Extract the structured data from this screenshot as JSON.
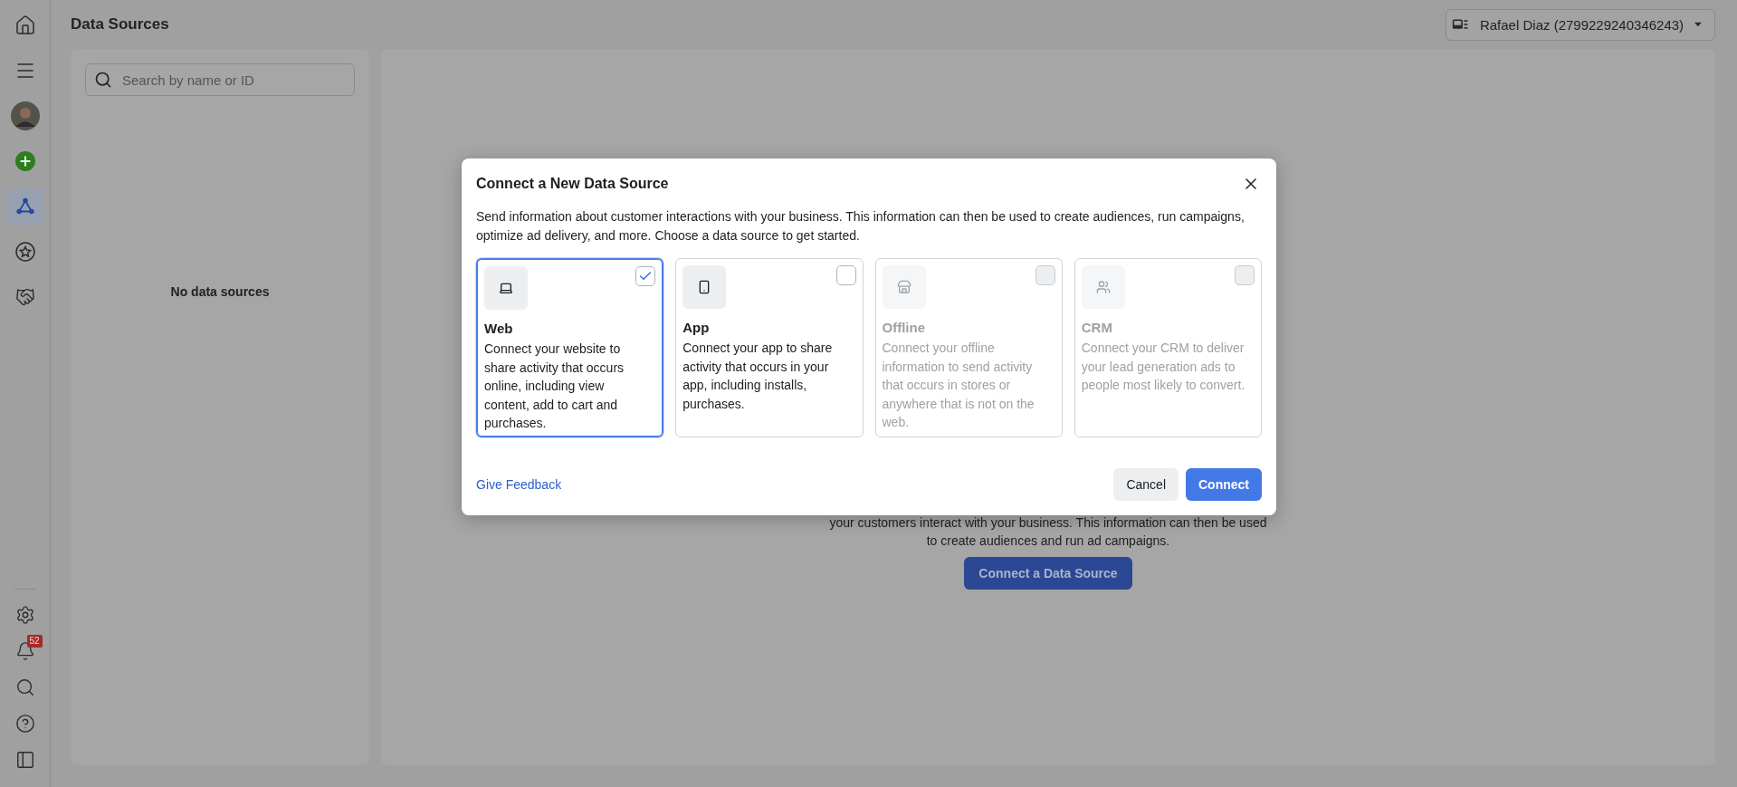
{
  "sidebar": {
    "top_items": [
      {
        "selected": false
      },
      {
        "selected": false
      },
      {
        "selected": false
      },
      {
        "selected": false
      },
      {
        "selected": true
      },
      {
        "selected": false
      },
      {
        "selected": false
      }
    ],
    "bottom_items": [
      {
        "selected": false
      },
      {
        "selected": false,
        "badge": "52"
      },
      {
        "selected": false
      },
      {
        "selected": false
      },
      {
        "selected": false
      }
    ]
  },
  "header": {
    "title": "Data Sources",
    "account": "Rafael Diaz (2799229240346243)"
  },
  "list_panel": {
    "search": {
      "placeholder": "Search by name or ID"
    },
    "empty_text": "No data sources"
  },
  "main_panel": {
    "text_lines": [
      "your customers interact with your business. This information can then be used",
      "to create audiences and run ad campaigns."
    ],
    "button": "Connect a Data Source"
  },
  "dialog": {
    "title": "Connect a New Data Source",
    "description": "Send information about customer interactions with your business. This information can then be used to create audiences, run campaigns, optimize ad delivery, and more. Choose a data source to get started.",
    "options": [
      {
        "title": "Web",
        "text": "Connect your website to share activity that occurs online, including view content, add to cart and purchases.",
        "selected": true,
        "disabled": false
      },
      {
        "title": "App",
        "text": "Connect your app to share activity that occurs in your app, including installs, purchases.",
        "selected": false,
        "disabled": false
      },
      {
        "title": "Offline",
        "text": "Connect your offline information to send activity that occurs in stores or anywhere that is not on the web.",
        "selected": false,
        "disabled": true
      },
      {
        "title": "CRM",
        "text": "Connect your CRM to deliver your lead generation ads to people most likely to convert.",
        "selected": false,
        "disabled": true
      }
    ],
    "feedback_link": "Give Feedback",
    "cancel": "Cancel",
    "confirm": "Connect"
  }
}
